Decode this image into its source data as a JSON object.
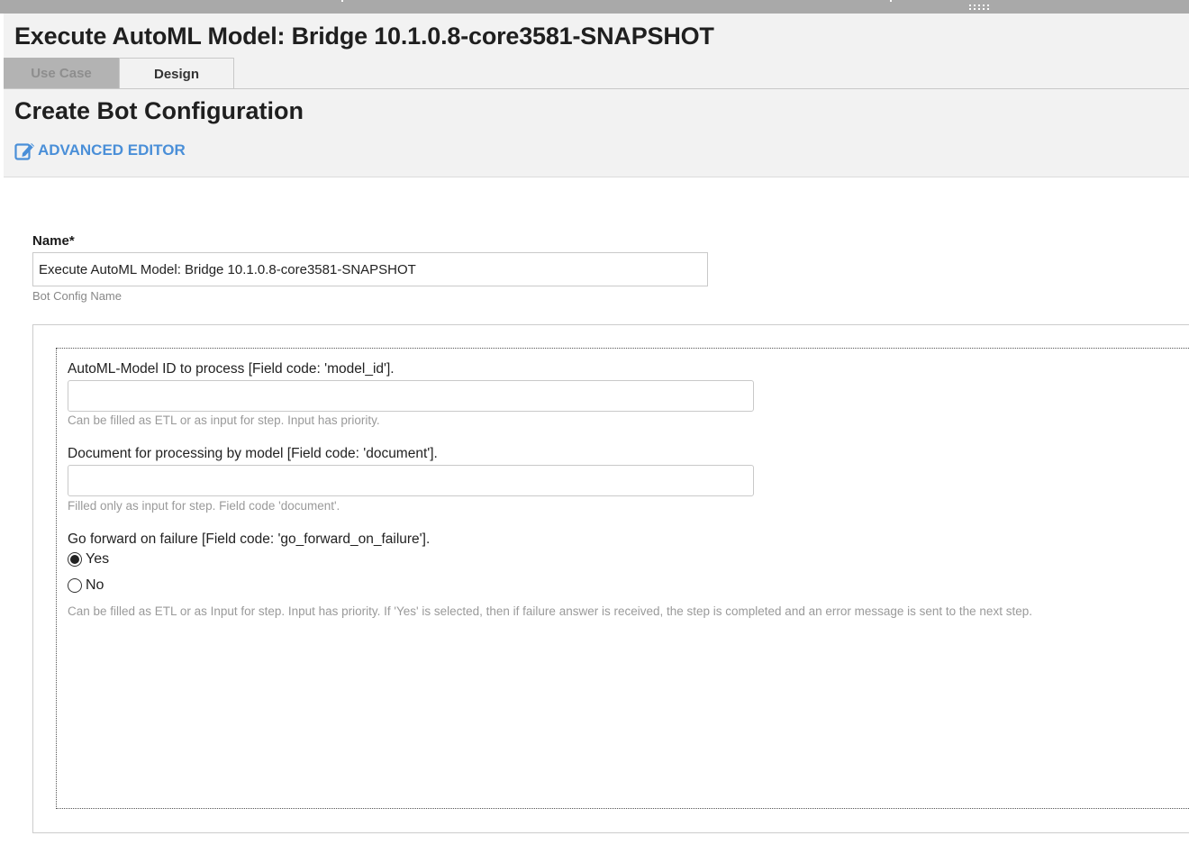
{
  "window": {
    "title": "Execute AutoML Model: Bridge 10.1.0.8-core3581-SNAPSHOT"
  },
  "tabs": [
    {
      "label": "Use Case",
      "active": false
    },
    {
      "label": "Design",
      "active": true
    }
  ],
  "section": {
    "title": "Create Bot Configuration",
    "advanced_editor_label": "ADVANCED EDITOR"
  },
  "name_field": {
    "label": "Name*",
    "value": "Execute AutoML Model: Bridge 10.1.0.8-core3581-SNAPSHOT",
    "hint": "Bot Config Name"
  },
  "fields": {
    "model_id": {
      "label": "AutoML-Model ID to process [Field code: 'model_id'].",
      "value": "",
      "hint": "Can be filled as ETL or as input for step. Input has priority."
    },
    "document": {
      "label": "Document for processing by model [Field code: 'document'].",
      "value": "",
      "hint": "Filled only as input for step. Field code 'document'."
    },
    "go_forward": {
      "label": "Go forward on failure [Field code: 'go_forward_on_failure'].",
      "options": [
        {
          "label": "Yes",
          "selected": true
        },
        {
          "label": "No",
          "selected": false
        }
      ],
      "hint": "Can be filled as ETL or as Input for step. Input has priority. If 'Yes' is selected, then if failure answer is received, the step is completed and an error message is sent to the next step."
    }
  },
  "icons": {
    "advanced_editor": "edit-icon"
  },
  "colors": {
    "accent_link": "#4a8fd8",
    "header_bg": "#f2f2f2",
    "topbar": "#a9a9a9",
    "inactive_tab": "#b3b3b3"
  }
}
